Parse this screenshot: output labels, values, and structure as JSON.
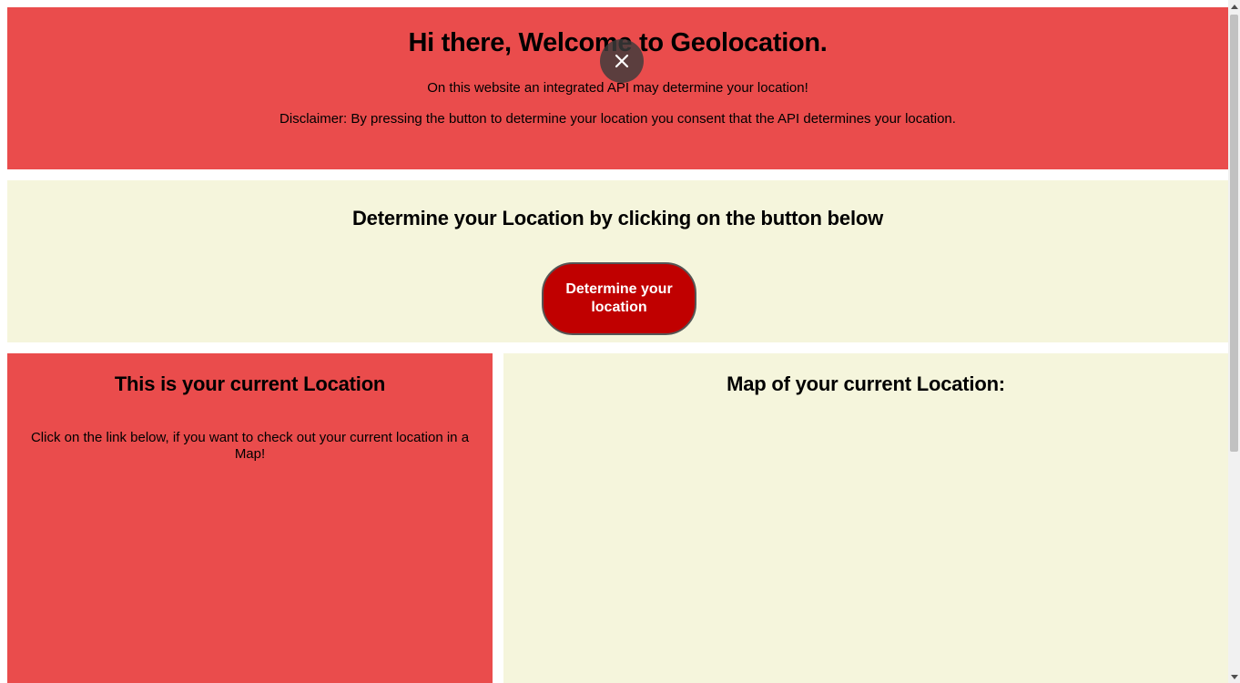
{
  "hero": {
    "title": "Hi there, Welcome to Geolocation.",
    "intro": "On this website an integrated API may determine your location!",
    "disclaimer": "Disclaimer: By pressing the button to determine your location you consent that the API determines your location.",
    "background": "#ea4c4c"
  },
  "overlay": {
    "close_icon": "close-icon"
  },
  "determine": {
    "heading": "Determine your Location by clicking on the button below",
    "button_label": "Determine your location",
    "button_color": "#c00000",
    "background": "#f5f5dc"
  },
  "location_panel": {
    "heading": "This is your current Location",
    "text": "Click on the link below, if you want to check out your current location in a Map!"
  },
  "map_panel": {
    "heading": "Map of your current Location:"
  },
  "scrollbar": {
    "up_icon": "arrow-up-icon",
    "down_icon": "arrow-down-icon"
  }
}
